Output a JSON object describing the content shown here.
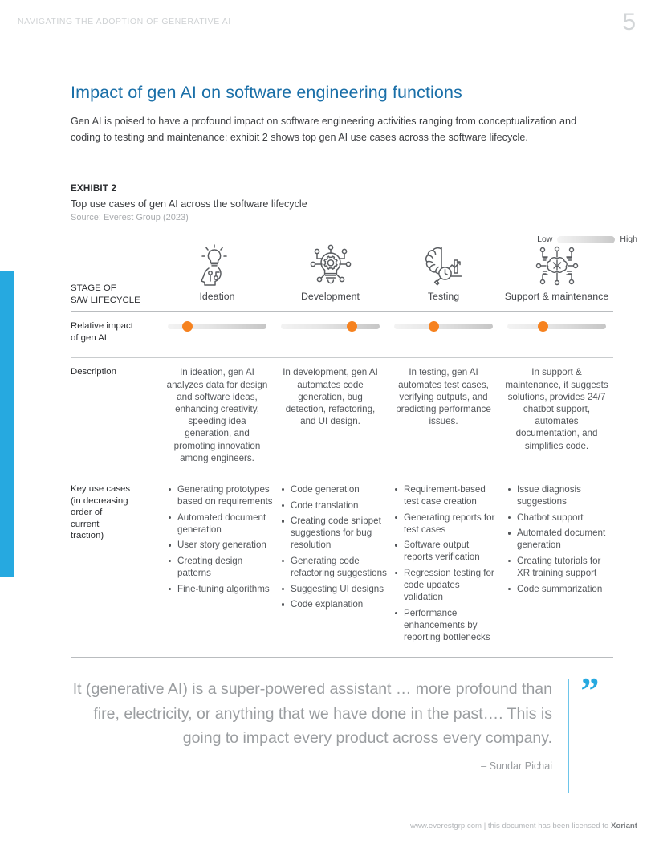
{
  "header": {
    "running_title": "NAVIGATING THE ADOPTION OF GENERATIVE AI",
    "page_number": "5"
  },
  "section": {
    "title": "Impact of gen AI on software engineering functions",
    "intro": "Gen AI is poised to have a profound impact on software engineering activities ranging from conceptualization and coding to testing and maintenance; exhibit 2 shows top gen AI use cases across the software lifecycle."
  },
  "exhibit": {
    "label": "EXHIBIT 2",
    "title": "Top use cases of gen AI across the software lifecycle",
    "source": "Source: Everest Group (2023)",
    "legend": {
      "low": "Low",
      "high": "High"
    },
    "row_labels": {
      "stage": "STAGE OF\nS/W LIFECYCLE",
      "stage_line1": "STAGE OF",
      "stage_line2": "S/W LIFECYCLE",
      "impact_line1": "Relative impact",
      "impact_line2": "of gen AI",
      "description": "Description",
      "uses_line1": "Key use cases",
      "uses_line2": "(in decreasing",
      "uses_line3": "order of",
      "uses_line4": "current",
      "uses_line5": "traction)"
    },
    "accent_color": "#26a9e0",
    "dot_color": "#f6821f",
    "columns": [
      {
        "stage": "Ideation",
        "icon": "lightbulb-head-icon",
        "impact_percent": 20,
        "description": "In ideation, gen AI analyzes data for design and software ideas, enhancing creativity, speeding idea generation, and promoting innovation among engineers.",
        "use_cases": [
          "Generating prototypes based on requirements",
          "Automated document generation",
          "User story generation",
          "Creating design patterns",
          "Fine-tuning algorithms"
        ]
      },
      {
        "stage": "Development",
        "icon": "lightbulb-gear-circuit-icon",
        "impact_percent": 72,
        "description": "In development, gen AI automates code generation, bug detection, refactoring, and UI design.",
        "use_cases": [
          "Code generation",
          "Code translation",
          "Creating code snippet suggestions for bug resolution",
          "Generating code refactoring suggestions",
          "Suggesting UI designs",
          "Code explanation"
        ]
      },
      {
        "stage": "Testing",
        "icon": "brain-magnifier-chart-icon",
        "impact_percent": 40,
        "description": "In testing, gen AI automates test cases, verifying outputs, and predicting performance issues.",
        "use_cases": [
          "Requirement-based test case creation",
          "Generating reports for test cases",
          "Software output reports verification",
          "Regression testing for code updates validation",
          "Performance enhancements by reporting bottlenecks"
        ]
      },
      {
        "stage": "Support & maintenance",
        "icon": "brain-network-icon",
        "impact_percent": 36,
        "description": "In support & maintenance, it suggests solutions, provides 24/7 chatbot support, automates documentation, and simplifies code.",
        "use_cases": [
          "Issue diagnosis suggestions",
          "Chatbot support",
          "Automated document generation",
          "Creating tutorials for XR training support",
          "Code summarization"
        ]
      }
    ]
  },
  "quote": {
    "text": "It (generative AI) is a super-powered assistant … more profound than fire, electricity, or anything that we have done in the past…. This is going to impact every product across every company.",
    "attribution": "– Sundar Pichai",
    "mark": "”"
  },
  "footer": {
    "text": "www.everestgrp.com | this document has been licensed to ",
    "licensee": "Xoriant"
  },
  "chart_data": {
    "type": "bar",
    "title": "Top use cases of gen AI across the software lifecycle",
    "subtitle": "Relative impact of gen AI",
    "categories": [
      "Ideation",
      "Development",
      "Testing",
      "Support & maintenance"
    ],
    "values": [
      20,
      72,
      40,
      36
    ],
    "xlabel": "Stage of S/W lifecycle",
    "ylabel": "Relative impact of gen AI",
    "ylim": [
      0,
      100
    ],
    "legend": [
      "Low",
      "High"
    ],
    "grid": false
  }
}
